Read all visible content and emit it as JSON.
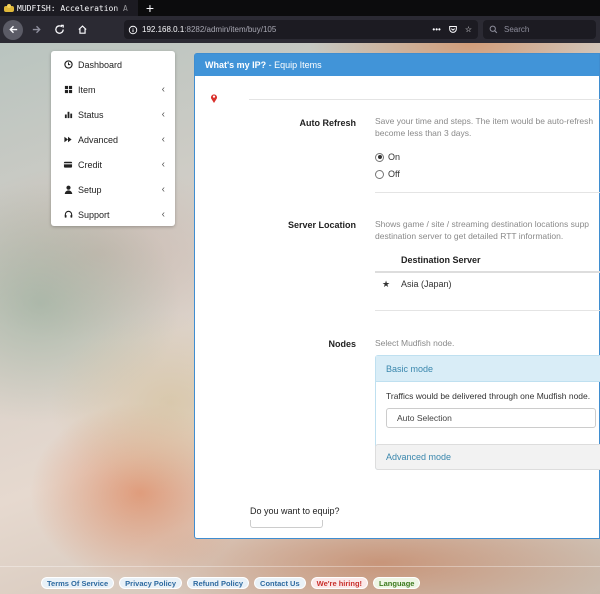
{
  "browser": {
    "tab_title": "MUDFISH: Acceleration A",
    "url_host": "192.168.0.1",
    "url_rest": ":8282/admin/item/buy/105",
    "search_placeholder": "Search"
  },
  "sidebar": {
    "items": [
      {
        "label": "Dashboard",
        "icon": "clock-icon",
        "has_submenu": false
      },
      {
        "label": "Item",
        "icon": "grid-icon",
        "has_submenu": true
      },
      {
        "label": "Status",
        "icon": "bar-chart-icon",
        "has_submenu": true
      },
      {
        "label": "Advanced",
        "icon": "fast-forward-icon",
        "has_submenu": true
      },
      {
        "label": "Credit",
        "icon": "credit-card-icon",
        "has_submenu": true
      },
      {
        "label": "Setup",
        "icon": "user-icon",
        "has_submenu": true
      },
      {
        "label": "Support",
        "icon": "headset-icon",
        "has_submenu": true
      }
    ],
    "chevron": "‹"
  },
  "panel": {
    "title_bold": "What's my IP?",
    "title_rest": " - Equip Items"
  },
  "auto_refresh": {
    "label": "Auto Refresh",
    "desc_line1": "Save your time and steps. The item would be auto-refresh",
    "desc_line2": "become less than 3 days.",
    "options": [
      {
        "label": "On",
        "selected": true
      },
      {
        "label": "Off",
        "selected": false
      }
    ]
  },
  "server_location": {
    "label": "Server Location",
    "desc_line1": "Shows game / site / streaming destination locations supp",
    "desc_line2": "destination server to get detailed RTT information.",
    "column_header": "Destination Server",
    "rows": [
      {
        "marker": "★",
        "value": "Asia (Japan)"
      }
    ]
  },
  "nodes": {
    "label": "Nodes",
    "desc": "Select Mudfish node.",
    "basic_mode": {
      "title": "Basic mode",
      "text": "Traffics would be delivered through one Mudfish node.",
      "selected": "Auto Selection"
    },
    "advanced_mode": {
      "title": "Advanced mode"
    }
  },
  "equip": {
    "question": "Do you want to equip?"
  },
  "footer": {
    "links": [
      {
        "label": "Terms Of Service",
        "style": "default"
      },
      {
        "label": "Privacy Policy",
        "style": "default"
      },
      {
        "label": "Refund Policy",
        "style": "default"
      },
      {
        "label": "Contact Us",
        "style": "default"
      },
      {
        "label": "We're hiring!",
        "style": "hire"
      },
      {
        "label": "Language",
        "style": "lang"
      }
    ]
  },
  "colors": {
    "panel_header": "#4194d8",
    "link": "#3a87ad",
    "browser_bg": "#2b2a33"
  }
}
